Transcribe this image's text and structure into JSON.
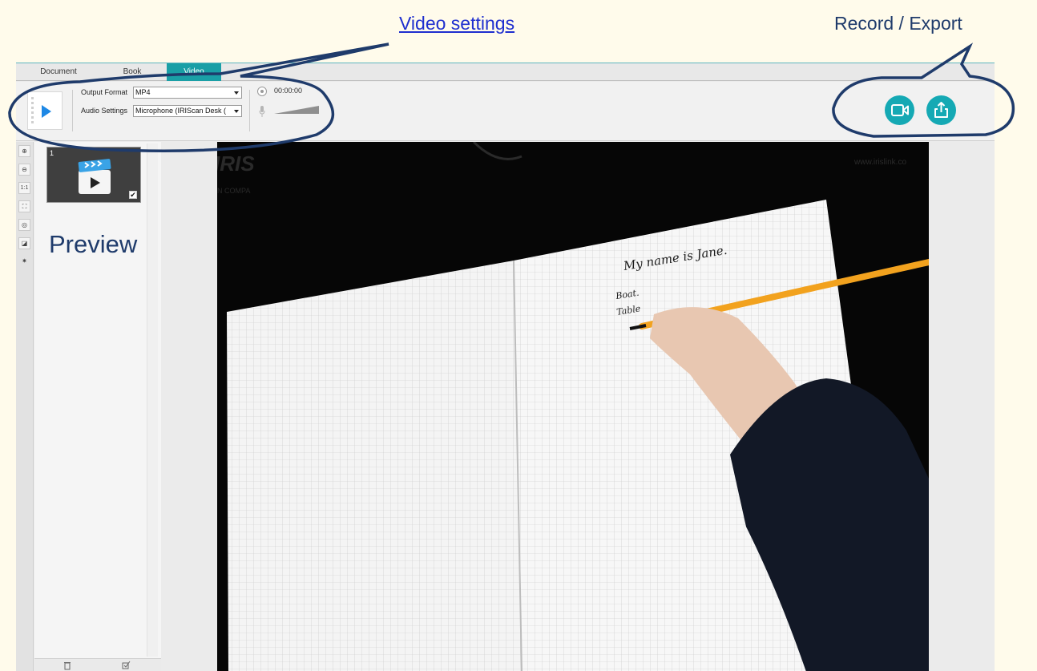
{
  "annotations": {
    "video_settings": "Video settings",
    "record_export": "Record / Export",
    "preview": "Preview"
  },
  "tabs": [
    {
      "label": "Document"
    },
    {
      "label": "Book"
    },
    {
      "label": "Video",
      "active": true
    }
  ],
  "toolbar": {
    "output_format_label": "Output Format",
    "output_format_value": "MP4",
    "audio_settings_label": "Audio Settings",
    "audio_settings_value": "Microphone (IRIScan Desk (",
    "timer": "00:00:00"
  },
  "left_tools": [
    "zoom-in",
    "zoom-out",
    "1:1",
    "fit",
    "webcam",
    "crop",
    "brightness"
  ],
  "tool_labels": {
    "one_to_one": "1:1"
  },
  "thumbnail": {
    "number": "1",
    "checked": "✔"
  },
  "preview_overlay": {
    "logo": "IRIS",
    "company": "N COMPA",
    "url": "www.irislink.co"
  },
  "notebook_writing": [
    "My name is Jane.",
    "Boat.",
    "Table"
  ],
  "colors": {
    "accent": "#15a9b4",
    "annotation_outline": "#1f3b6b",
    "page_bg": "#fffbeb",
    "link": "#1f2fcf"
  }
}
